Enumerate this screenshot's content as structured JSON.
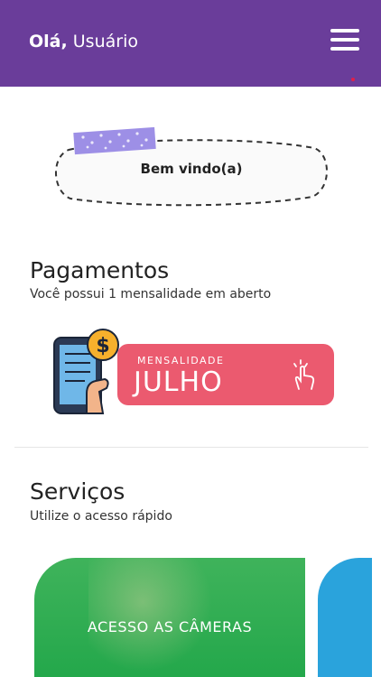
{
  "header": {
    "greeting_bold": "Olá,",
    "greeting_name": "Usuário"
  },
  "welcome": {
    "text": "Bem vindo(a)"
  },
  "payments": {
    "title": "Pagamentos",
    "subtitle": "Você possui 1 mensalidade em aberto",
    "banner_small": "MENSALIDADE",
    "banner_big": "JULHO"
  },
  "services": {
    "title": "Serviços",
    "subtitle": "Utilize o acesso rápido",
    "cards": [
      {
        "label": "ACESSO AS CÂMERAS"
      }
    ]
  },
  "colors": {
    "header": "#6a3d9a",
    "banner": "#eb5a6f",
    "card_green": "#22a74a",
    "card_blue": "#2aa3dc"
  },
  "icons": [
    "menu-icon",
    "phone-payment-icon",
    "tap-hand-icon"
  ]
}
